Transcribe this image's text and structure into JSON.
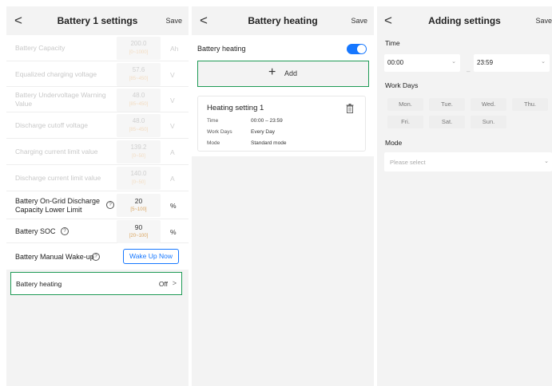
{
  "panel1": {
    "back": "<",
    "title": "Battery 1 settings",
    "save": "Save",
    "rows": [
      {
        "label": "Battery Capacity",
        "value": "200.0",
        "range": "[0~1000]",
        "unit": "Ah",
        "enabled": false
      },
      {
        "label": "Equalized charging voltage",
        "value": "57.6",
        "range": "[85~450]",
        "unit": "V",
        "enabled": false
      },
      {
        "label": "Battery Undervoltage Warning Value",
        "value": "48.0",
        "range": "[85~450]",
        "unit": "V",
        "enabled": false
      },
      {
        "label": "Discharge cutoff voltage",
        "value": "48.0",
        "range": "[85~450]",
        "unit": "V",
        "enabled": false
      },
      {
        "label": "Charging current limit value",
        "value": "139.2",
        "range": "[0~50]",
        "unit": "A",
        "enabled": false
      },
      {
        "label": "Discharge current limit value",
        "value": "140.0",
        "range": "[0~50]",
        "unit": "A",
        "enabled": false
      },
      {
        "label": "Battery On-Grid Discharge Capacity Lower Limit",
        "value": "20",
        "range": "[5~100]",
        "unit": "%",
        "enabled": true
      },
      {
        "label": "Battery SOC",
        "value": "90",
        "range": "[20~100]",
        "unit": "%",
        "enabled": true
      }
    ],
    "help_glyph": "?",
    "wake_label": "Battery Manual Wake-up",
    "wake_button": "Wake Up Now",
    "heating_label": "Battery heating",
    "heating_value": "Off",
    "heating_chevron": ">"
  },
  "panel2": {
    "back": "<",
    "title": "Battery heating",
    "save": "Save",
    "toggle_label": "Battery heating",
    "toggle_on": true,
    "add_plus": "+",
    "add_label": "Add",
    "card": {
      "title": "Heating setting 1",
      "items": [
        {
          "key": "Time",
          "value": "00:00 – 23:59"
        },
        {
          "key": "Work Days",
          "value": "Every Day"
        },
        {
          "key": "Mode",
          "value": "Standard mode"
        }
      ]
    }
  },
  "panel3": {
    "back": "<",
    "title": "Adding settings",
    "save": "Save",
    "time_label": "Time",
    "start_time": "00:00",
    "end_time": "23:59",
    "dash": "–",
    "chevron": "⌄",
    "workdays_label": "Work Days",
    "days": [
      "Mon.",
      "Tue.",
      "Wed.",
      "Thu.",
      "Fri.",
      "Sat.",
      "Sun."
    ],
    "mode_label": "Mode",
    "mode_placeholder": "Please select"
  },
  "colors": {
    "accent": "#1677ff",
    "highlight_border": "#1e9a55",
    "range_text": "#d9a45f",
    "panel_bg": "#f3f3f3"
  }
}
